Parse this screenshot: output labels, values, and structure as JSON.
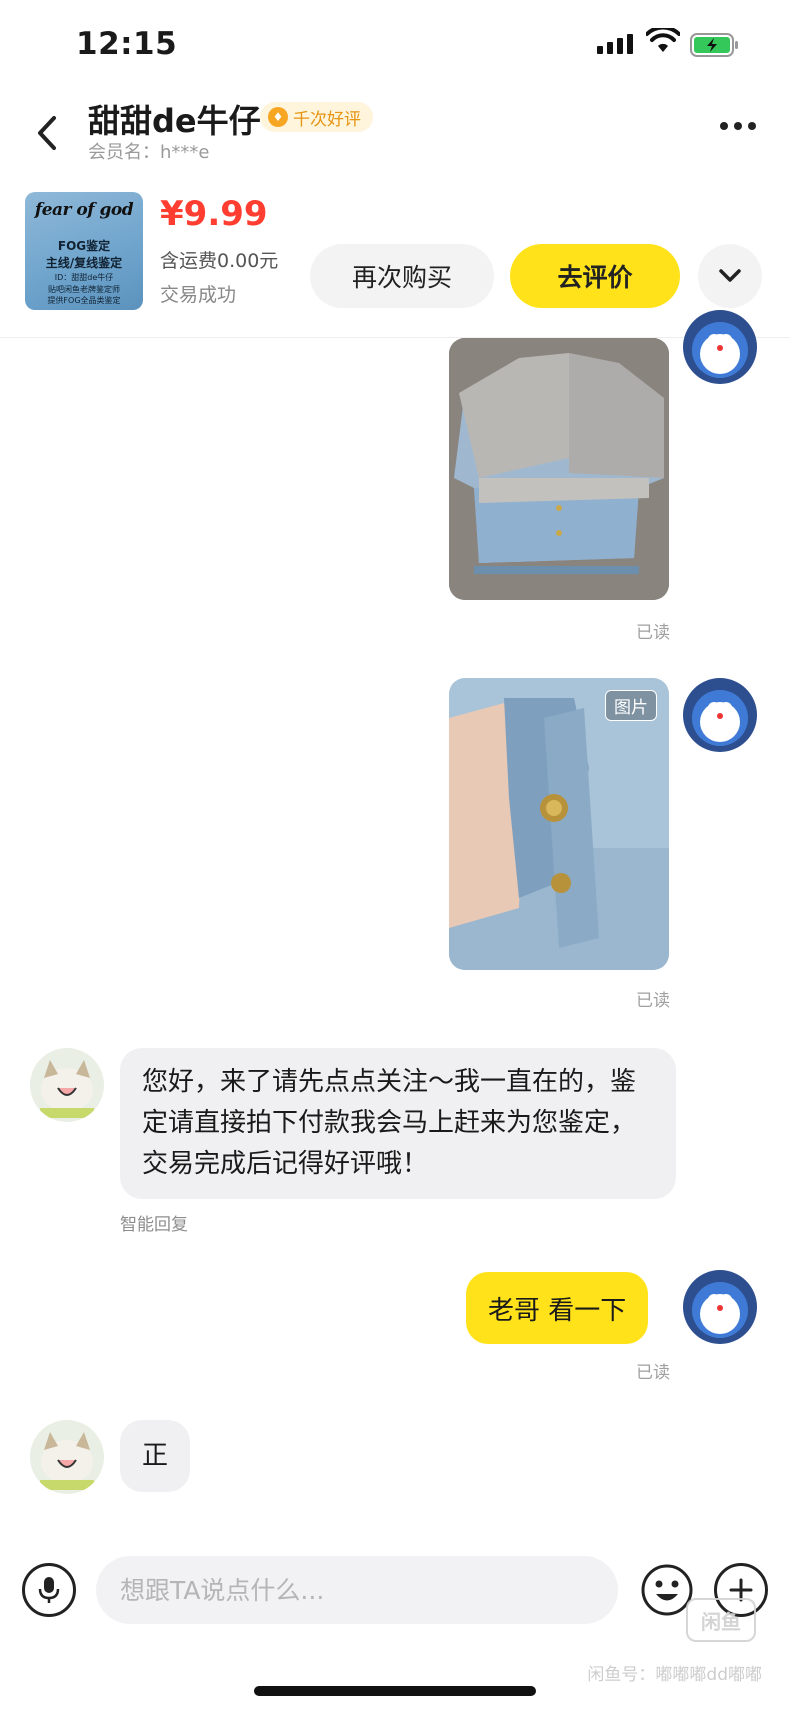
{
  "status_bar": {
    "time": "12:15"
  },
  "header": {
    "nickname": "甜甜de牛仔",
    "badge_text": "千次好评",
    "member_label": "会员名：h***e"
  },
  "product": {
    "image_lines": {
      "brand": "fear of god",
      "line1": "FOG鉴定",
      "line2": "主线/复线鉴定",
      "line3": "ID：甜甜de牛仔",
      "line4": "贴吧闲鱼老牌鉴定师",
      "line5": "提供FOG全品类鉴定"
    },
    "price": "¥9.99",
    "shipping": "含运费0.00元",
    "status": "交易成功",
    "rebuy_label": "再次购买",
    "review_label": "去评价"
  },
  "chat": {
    "photo_tag": "图片",
    "read_label": "已读",
    "incoming_message_1": "您好，来了请先点点关注～我一直在的，鉴定请直接拍下付款我会马上赶来为您鉴定，交易完成后记得好评哦！",
    "auto_reply_label": "智能回复",
    "outgoing_message_1": "老哥 看一下",
    "incoming_message_2": "正"
  },
  "input_bar": {
    "placeholder": "想跟TA说点什么..."
  },
  "watermark": {
    "logo_text": "闲鱼",
    "text": "闲鱼号：嘟嘟嘟dd嘟嘟"
  },
  "colors": {
    "accent_yellow": "#ffe21a",
    "price_red": "#ff3d30",
    "badge_orange": "#e79410"
  },
  "icons": {
    "back": "chevron-left-icon",
    "more": "more-dots-icon",
    "expand": "chevron-down-icon",
    "mic": "microphone-icon",
    "emoji": "smiley-icon",
    "plus": "plus-icon"
  }
}
